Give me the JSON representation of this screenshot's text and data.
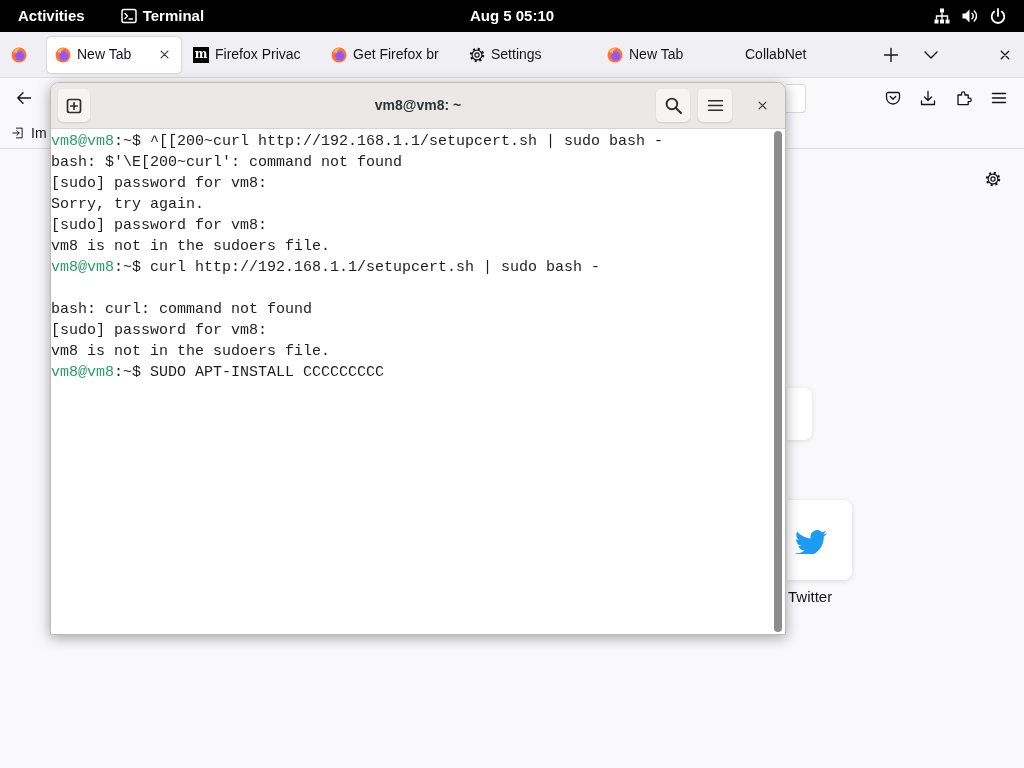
{
  "top_bar": {
    "activities": "Activities",
    "app_name": "Terminal",
    "clock": "Aug 5 05:10"
  },
  "browser": {
    "tabs": [
      {
        "title": "New Tab",
        "kind": "browser",
        "selected": true
      },
      {
        "title": "Firefox Privac",
        "kind": "monogram",
        "favicon_letter": "m",
        "selected": false
      },
      {
        "title": "Get Firefox br",
        "kind": "browser",
        "selected": false
      },
      {
        "title": "Settings",
        "kind": "settings",
        "selected": false
      },
      {
        "title": "New Tab",
        "kind": "browser",
        "selected": false
      },
      {
        "title": "CollabNet",
        "kind": "plain",
        "selected": false
      }
    ],
    "bookmarks": [
      {
        "label": "Im"
      }
    ],
    "new_tab_page": {
      "search_field": true,
      "shortcuts": [
        {
          "label": "Twitter"
        }
      ]
    }
  },
  "terminal": {
    "title": "vm8@vm8: ~",
    "lines": [
      {
        "kind": "prompt",
        "user_host": "vm8@vm8",
        "prompt_tail": ":~$",
        "command": "^[[200~curl http://192.168.1.1/setupcert.sh | sudo bash -"
      },
      {
        "kind": "output",
        "text": "bash: $'\\E[200~curl': command not found"
      },
      {
        "kind": "output",
        "text": "[sudo] password for vm8:"
      },
      {
        "kind": "output",
        "text": "Sorry, try again."
      },
      {
        "kind": "output",
        "text": "[sudo] password for vm8:"
      },
      {
        "kind": "output",
        "text": "vm8 is not in the sudoers file."
      },
      {
        "kind": "prompt",
        "user_host": "vm8@vm8",
        "prompt_tail": ":~$",
        "command": "curl http://192.168.1.1/setupcert.sh | sudo bash -"
      },
      {
        "kind": "blank"
      },
      {
        "kind": "output",
        "text": "bash: curl: command not found"
      },
      {
        "kind": "output",
        "text": "[sudo] password for vm8:"
      },
      {
        "kind": "output",
        "text": "vm8 is not in the sudoers file."
      },
      {
        "kind": "prompt",
        "user_host": "vm8@vm8",
        "prompt_tail": ":~$",
        "command": "SUDO APT-INSTALL CCCCCCCCC"
      }
    ]
  }
}
